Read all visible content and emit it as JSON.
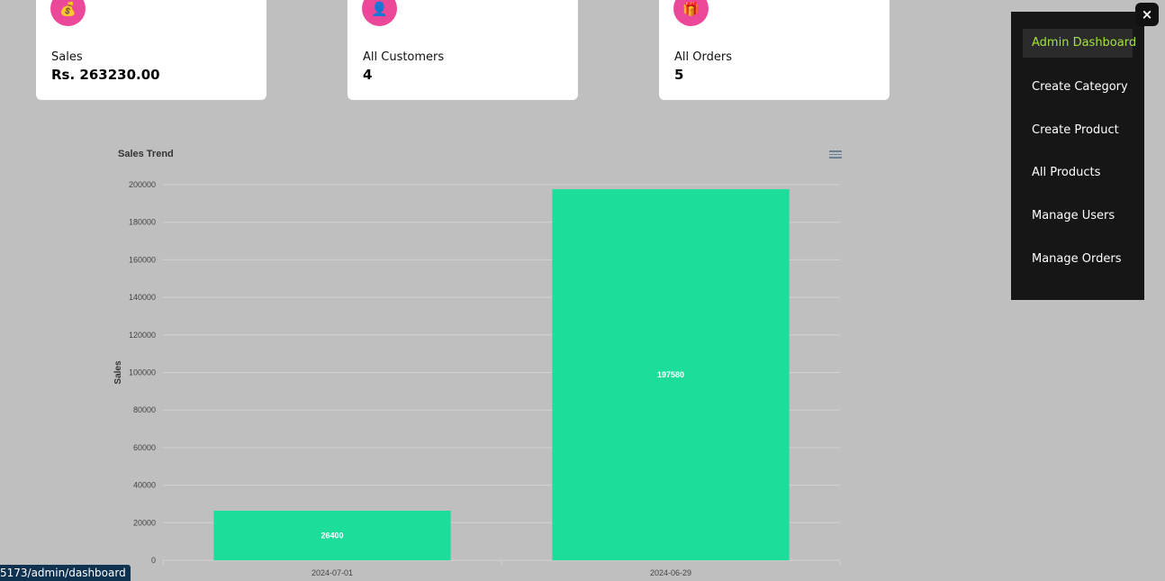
{
  "cards": [
    {
      "label": "Sales",
      "value": "Rs. 263230.00",
      "icon": "money-bag-icon",
      "glyph": "💰"
    },
    {
      "label": "All Customers",
      "value": "4",
      "icon": "customer-icon",
      "glyph": "👤"
    },
    {
      "label": "All Orders",
      "value": "5",
      "icon": "gift-icon",
      "glyph": "🎁"
    }
  ],
  "colors": {
    "accent": "#ec4899",
    "bar": "#1ddd9b",
    "active_nav": "#a3e635",
    "sidebar": "#161616"
  },
  "sidebar": {
    "items": [
      {
        "label": "Admin Dashboard",
        "active": true
      },
      {
        "label": "Create Category"
      },
      {
        "label": "Create Product"
      },
      {
        "label": "All Products"
      },
      {
        "label": "Manage Users"
      },
      {
        "label": "Manage Orders"
      }
    ],
    "close_glyph": "×"
  },
  "status_url": "5173/admin/dashboard",
  "chart_data": {
    "type": "bar",
    "title": "Sales Trend",
    "categories": [
      "2024-07-01",
      "2024-06-29"
    ],
    "values": [
      26400,
      197580
    ],
    "ylabel": "Sales",
    "xlabel": "",
    "ylim": [
      0,
      200000
    ],
    "yticks": [
      0,
      20000,
      40000,
      60000,
      80000,
      100000,
      120000,
      140000,
      160000,
      180000,
      200000
    ],
    "data_labels": true,
    "grid": true
  }
}
